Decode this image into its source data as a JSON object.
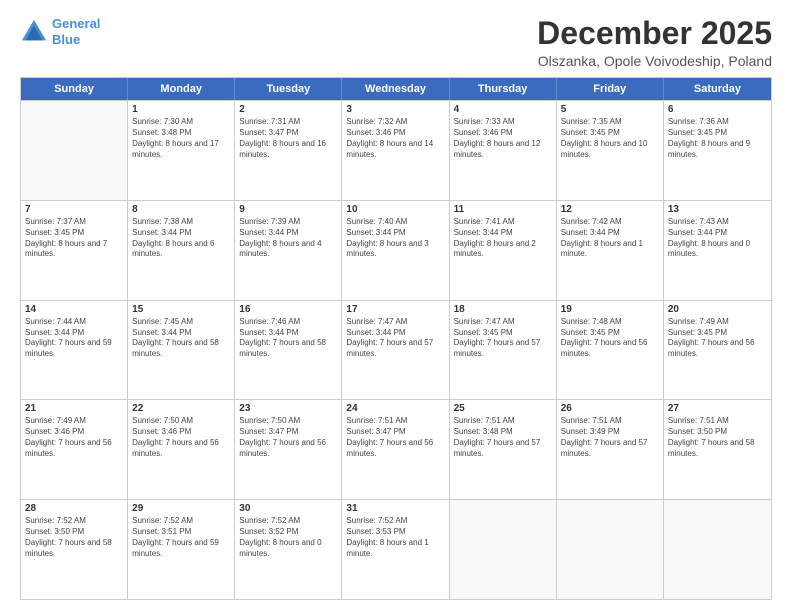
{
  "header": {
    "logo_line1": "General",
    "logo_line2": "Blue",
    "main_title": "December 2025",
    "sub_title": "Olszanka, Opole Voivodeship, Poland"
  },
  "days_of_week": [
    "Sunday",
    "Monday",
    "Tuesday",
    "Wednesday",
    "Thursday",
    "Friday",
    "Saturday"
  ],
  "weeks": [
    [
      {
        "day": "",
        "sunrise": "",
        "sunset": "",
        "daylight": ""
      },
      {
        "day": "1",
        "sunrise": "Sunrise: 7:30 AM",
        "sunset": "Sunset: 3:48 PM",
        "daylight": "Daylight: 8 hours and 17 minutes."
      },
      {
        "day": "2",
        "sunrise": "Sunrise: 7:31 AM",
        "sunset": "Sunset: 3:47 PM",
        "daylight": "Daylight: 8 hours and 16 minutes."
      },
      {
        "day": "3",
        "sunrise": "Sunrise: 7:32 AM",
        "sunset": "Sunset: 3:46 PM",
        "daylight": "Daylight: 8 hours and 14 minutes."
      },
      {
        "day": "4",
        "sunrise": "Sunrise: 7:33 AM",
        "sunset": "Sunset: 3:46 PM",
        "daylight": "Daylight: 8 hours and 12 minutes."
      },
      {
        "day": "5",
        "sunrise": "Sunrise: 7:35 AM",
        "sunset": "Sunset: 3:45 PM",
        "daylight": "Daylight: 8 hours and 10 minutes."
      },
      {
        "day": "6",
        "sunrise": "Sunrise: 7:36 AM",
        "sunset": "Sunset: 3:45 PM",
        "daylight": "Daylight: 8 hours and 9 minutes."
      }
    ],
    [
      {
        "day": "7",
        "sunrise": "Sunrise: 7:37 AM",
        "sunset": "Sunset: 3:45 PM",
        "daylight": "Daylight: 8 hours and 7 minutes."
      },
      {
        "day": "8",
        "sunrise": "Sunrise: 7:38 AM",
        "sunset": "Sunset: 3:44 PM",
        "daylight": "Daylight: 8 hours and 6 minutes."
      },
      {
        "day": "9",
        "sunrise": "Sunrise: 7:39 AM",
        "sunset": "Sunset: 3:44 PM",
        "daylight": "Daylight: 8 hours and 4 minutes."
      },
      {
        "day": "10",
        "sunrise": "Sunrise: 7:40 AM",
        "sunset": "Sunset: 3:44 PM",
        "daylight": "Daylight: 8 hours and 3 minutes."
      },
      {
        "day": "11",
        "sunrise": "Sunrise: 7:41 AM",
        "sunset": "Sunset: 3:44 PM",
        "daylight": "Daylight: 8 hours and 2 minutes."
      },
      {
        "day": "12",
        "sunrise": "Sunrise: 7:42 AM",
        "sunset": "Sunset: 3:44 PM",
        "daylight": "Daylight: 8 hours and 1 minute."
      },
      {
        "day": "13",
        "sunrise": "Sunrise: 7:43 AM",
        "sunset": "Sunset: 3:44 PM",
        "daylight": "Daylight: 8 hours and 0 minutes."
      }
    ],
    [
      {
        "day": "14",
        "sunrise": "Sunrise: 7:44 AM",
        "sunset": "Sunset: 3:44 PM",
        "daylight": "Daylight: 7 hours and 59 minutes."
      },
      {
        "day": "15",
        "sunrise": "Sunrise: 7:45 AM",
        "sunset": "Sunset: 3:44 PM",
        "daylight": "Daylight: 7 hours and 58 minutes."
      },
      {
        "day": "16",
        "sunrise": "Sunrise: 7:46 AM",
        "sunset": "Sunset: 3:44 PM",
        "daylight": "Daylight: 7 hours and 58 minutes."
      },
      {
        "day": "17",
        "sunrise": "Sunrise: 7:47 AM",
        "sunset": "Sunset: 3:44 PM",
        "daylight": "Daylight: 7 hours and 57 minutes."
      },
      {
        "day": "18",
        "sunrise": "Sunrise: 7:47 AM",
        "sunset": "Sunset: 3:45 PM",
        "daylight": "Daylight: 7 hours and 57 minutes."
      },
      {
        "day": "19",
        "sunrise": "Sunrise: 7:48 AM",
        "sunset": "Sunset: 3:45 PM",
        "daylight": "Daylight: 7 hours and 56 minutes."
      },
      {
        "day": "20",
        "sunrise": "Sunrise: 7:49 AM",
        "sunset": "Sunset: 3:45 PM",
        "daylight": "Daylight: 7 hours and 56 minutes."
      }
    ],
    [
      {
        "day": "21",
        "sunrise": "Sunrise: 7:49 AM",
        "sunset": "Sunset: 3:46 PM",
        "daylight": "Daylight: 7 hours and 56 minutes."
      },
      {
        "day": "22",
        "sunrise": "Sunrise: 7:50 AM",
        "sunset": "Sunset: 3:46 PM",
        "daylight": "Daylight: 7 hours and 56 minutes."
      },
      {
        "day": "23",
        "sunrise": "Sunrise: 7:50 AM",
        "sunset": "Sunset: 3:47 PM",
        "daylight": "Daylight: 7 hours and 56 minutes."
      },
      {
        "day": "24",
        "sunrise": "Sunrise: 7:51 AM",
        "sunset": "Sunset: 3:47 PM",
        "daylight": "Daylight: 7 hours and 56 minutes."
      },
      {
        "day": "25",
        "sunrise": "Sunrise: 7:51 AM",
        "sunset": "Sunset: 3:48 PM",
        "daylight": "Daylight: 7 hours and 57 minutes."
      },
      {
        "day": "26",
        "sunrise": "Sunrise: 7:51 AM",
        "sunset": "Sunset: 3:49 PM",
        "daylight": "Daylight: 7 hours and 57 minutes."
      },
      {
        "day": "27",
        "sunrise": "Sunrise: 7:51 AM",
        "sunset": "Sunset: 3:50 PM",
        "daylight": "Daylight: 7 hours and 58 minutes."
      }
    ],
    [
      {
        "day": "28",
        "sunrise": "Sunrise: 7:52 AM",
        "sunset": "Sunset: 3:50 PM",
        "daylight": "Daylight: 7 hours and 58 minutes."
      },
      {
        "day": "29",
        "sunrise": "Sunrise: 7:52 AM",
        "sunset": "Sunset: 3:51 PM",
        "daylight": "Daylight: 7 hours and 59 minutes."
      },
      {
        "day": "30",
        "sunrise": "Sunrise: 7:52 AM",
        "sunset": "Sunset: 3:52 PM",
        "daylight": "Daylight: 8 hours and 0 minutes."
      },
      {
        "day": "31",
        "sunrise": "Sunrise: 7:52 AM",
        "sunset": "Sunset: 3:53 PM",
        "daylight": "Daylight: 8 hours and 1 minute."
      },
      {
        "day": "",
        "sunrise": "",
        "sunset": "",
        "daylight": ""
      },
      {
        "day": "",
        "sunrise": "",
        "sunset": "",
        "daylight": ""
      },
      {
        "day": "",
        "sunrise": "",
        "sunset": "",
        "daylight": ""
      }
    ]
  ]
}
